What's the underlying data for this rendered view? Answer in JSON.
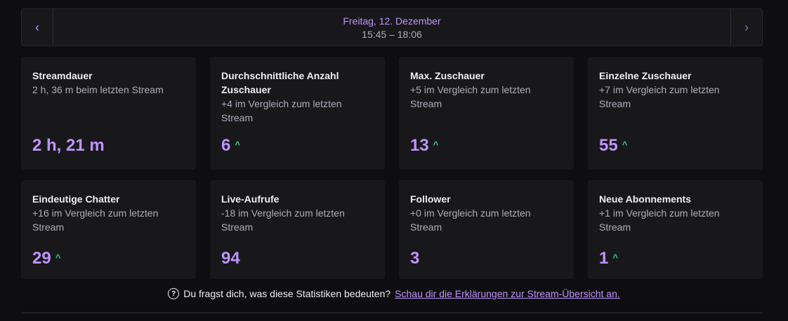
{
  "date_nav": {
    "prev_icon": "chevron-left",
    "prev_glyph": "‹",
    "next_icon": "chevron-right",
    "next_glyph": "›",
    "date": "Freitag, 12. Dezember",
    "time_range": "15:45 – 18:06"
  },
  "stats": [
    {
      "title": "Streamdauer",
      "subtitle": "2 h, 36 m beim letzten Stream",
      "value": "2 h, 21 m",
      "trend": ""
    },
    {
      "title": "Durchschnittliche Anzahl Zuschauer",
      "subtitle": "+4 im Vergleich zum letzten Stream",
      "value": "6",
      "trend": "up"
    },
    {
      "title": "Max. Zuschauer",
      "subtitle": "+5 im Vergleich zum letzten Stream",
      "value": "13",
      "trend": "up"
    },
    {
      "title": "Einzelne Zuschauer",
      "subtitle": "+7 im Vergleich zum letzten Stream",
      "value": "55",
      "trend": "up"
    },
    {
      "title": "Eindeutige Chatter",
      "subtitle": "+16 im Vergleich zum letzten Stream",
      "value": "29",
      "trend": "up"
    },
    {
      "title": "Live-Aufrufe",
      "subtitle": "-18 im Vergleich zum letzten Stream",
      "value": "94",
      "trend": ""
    },
    {
      "title": "Follower",
      "subtitle": "+0 im Vergleich zum letzten Stream",
      "value": "3",
      "trend": ""
    },
    {
      "title": "Neue Abonnements",
      "subtitle": "+1 im Vergleich zum letzten Stream",
      "value": "1",
      "trend": "up"
    }
  ],
  "trend_glyph": "^",
  "footer": {
    "icon": "question-circle",
    "icon_glyph": "?",
    "question": "Du fragst dich, was diese Statistiken bedeuten?",
    "link_text": "Schau dir die Erklärungen zur Stream-Übersicht an."
  },
  "colors": {
    "accent": "#bf94ff",
    "trend_up": "#2fd18a",
    "background": "#0e0e10",
    "card": "#18181b"
  }
}
